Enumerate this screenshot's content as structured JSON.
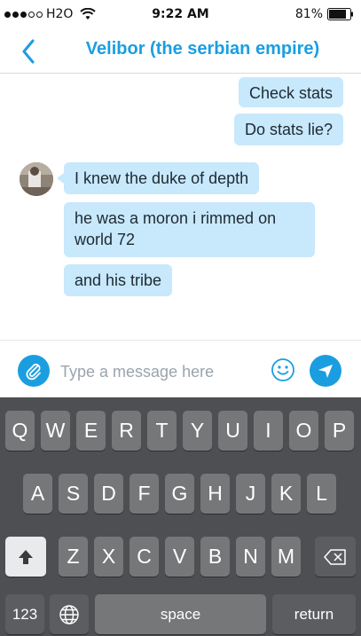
{
  "status_bar": {
    "carrier": "H2O",
    "time": "9:22 AM",
    "battery": "81%",
    "signal_bars_filled": 3,
    "battery_level": 0.81
  },
  "nav": {
    "title": "Velibor (the serbian empire)",
    "back_icon": "chevron-left-icon"
  },
  "messages": {
    "outgoing": [
      "Check stats",
      "Do stats lie?"
    ],
    "incoming": [
      "I knew the duke of depth",
      "he was a moron i rimmed on world 72",
      "and his tribe"
    ]
  },
  "input": {
    "placeholder": "Type a message here",
    "value": ""
  },
  "keyboard": {
    "row1": [
      "Q",
      "W",
      "E",
      "R",
      "T",
      "Y",
      "U",
      "I",
      "O",
      "P"
    ],
    "row2": [
      "A",
      "S",
      "D",
      "F",
      "G",
      "H",
      "J",
      "K",
      "L"
    ],
    "row3": [
      "Z",
      "X",
      "C",
      "V",
      "B",
      "N",
      "M"
    ],
    "numbers_key": "123",
    "space_key": "space",
    "return_key": "return"
  },
  "colors": {
    "accent": "#1a9ee0",
    "bubble": "#c8e8fb",
    "keyboard_bg": "#4d4f52",
    "key_bg": "#757779"
  }
}
